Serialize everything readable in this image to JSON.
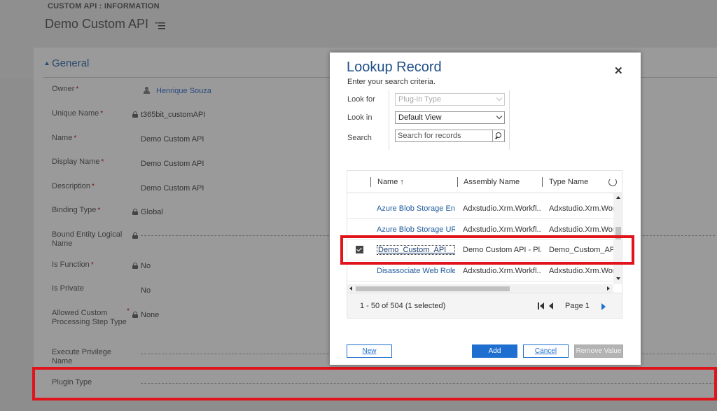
{
  "header": {
    "entity_label": "CUSTOM API : INFORMATION",
    "record_title": "Demo Custom API"
  },
  "section": {
    "title": "General"
  },
  "fields": [
    {
      "label": "Owner",
      "required": "*",
      "value": "Henrique Souza"
    },
    {
      "label": "Unique Name",
      "required": "*",
      "value": "t365bit_customAPI"
    },
    {
      "label": "Name",
      "required": "*",
      "value": "Demo Custom API"
    },
    {
      "label": "Display Name",
      "required": "*",
      "value": "Demo Custom API"
    },
    {
      "label": "Description",
      "required": "*",
      "value": "Demo Custom API"
    },
    {
      "label": "Binding Type",
      "required": "*",
      "value": "Global"
    },
    {
      "label": "Bound Entity Logical Name",
      "required": "",
      "value": ""
    },
    {
      "label": "Is Function",
      "required": "*",
      "value": "No"
    },
    {
      "label": "Is Private",
      "required": "",
      "value": "No"
    },
    {
      "label": "Allowed Custom Processing Step Type",
      "required": "*",
      "value": "None"
    },
    {
      "label": "Execute Privilege Name",
      "required": "",
      "value": ""
    },
    {
      "label": "Plugin Type",
      "required": "",
      "value": ""
    }
  ],
  "dialog": {
    "title": "Lookup Record",
    "subtitle": "Enter your search criteria.",
    "look_for_label": "Look for",
    "look_for_value": "Plug-in Type",
    "look_in_label": "Look in",
    "look_in_value": "Default View",
    "search_label": "Search",
    "search_placeholder": "Search for records",
    "columns": [
      "Name ↑",
      "Assembly Name",
      "Type Name"
    ],
    "rows": [
      {
        "name": "Azure Blob Storage En...",
        "assembly": "Adxstudio.Xrm.Workfl...",
        "type": "Adxstudio.Xrm.Work",
        "selected": false
      },
      {
        "name": "Azure Blob Storage URL",
        "assembly": "Adxstudio.Xrm.Workfl...",
        "type": "Adxstudio.Xrm.Work",
        "selected": false
      },
      {
        "name": "Demo_Custom_API___...",
        "assembly": "Demo Custom API - Pl...",
        "type": "Demo_Custom_API_",
        "selected": true
      },
      {
        "name": "Disassociate Web Role",
        "assembly": "Adxstudio.Xrm.Workfl...",
        "type": "Adxstudio.Xrm.Work",
        "selected": false
      }
    ],
    "record_count": "1 - 50 of 504 (1 selected)",
    "page_label": "Page 1",
    "buttons": {
      "new": "New",
      "add": "Add",
      "cancel": "Cancel",
      "remove": "Remove Value"
    }
  },
  "colors": {
    "accent": "#1e6fd0",
    "highlight": "#e0141a",
    "title": "#1e4e86"
  }
}
